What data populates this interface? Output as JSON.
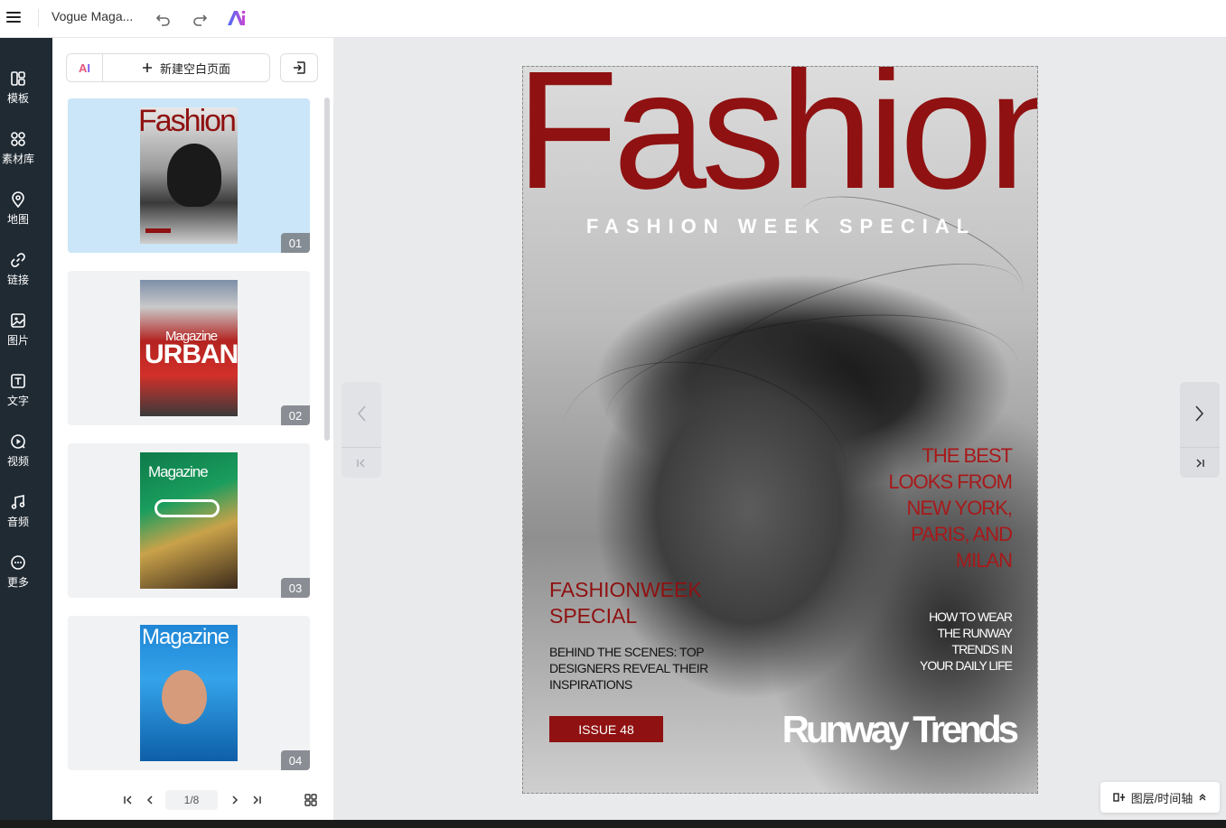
{
  "topbar": {
    "doc_title": "Vogue Maga...",
    "icons": [
      "menu-icon",
      "undo-icon",
      "redo-icon",
      "ai-logo-icon"
    ]
  },
  "rail": {
    "items": [
      {
        "label": "模板",
        "icon": "template-icon"
      },
      {
        "label": "素材库",
        "icon": "assets-icon"
      },
      {
        "label": "地图",
        "icon": "map-pin-icon"
      },
      {
        "label": "链接",
        "icon": "link-icon"
      },
      {
        "label": "图片",
        "icon": "image-icon"
      },
      {
        "label": "文字",
        "icon": "text-icon"
      },
      {
        "label": "视频",
        "icon": "video-icon"
      },
      {
        "label": "音频",
        "icon": "audio-icon"
      },
      {
        "label": "更多",
        "icon": "more-icon"
      }
    ]
  },
  "pages_panel": {
    "ai_label_a": "A",
    "ai_label_i": "I",
    "new_page_label": "新建空白页面",
    "thumbnails": [
      {
        "num": "01",
        "title": "Fashion",
        "active": true
      },
      {
        "num": "02",
        "title": "URBAN",
        "kicker": "Magazine",
        "active": false
      },
      {
        "num": "03",
        "title": "Magazine",
        "active": false
      },
      {
        "num": "04",
        "title": "Magazine",
        "active": false
      }
    ],
    "pager": {
      "current": "1/8"
    }
  },
  "cover": {
    "title": "Fashion",
    "subtitle": "FASHION WEEK SPECIAL",
    "headline_lines": [
      "THE BEST",
      "LOOKS FROM",
      "NEW YORK,",
      "PARIS, AND",
      "MILAN"
    ],
    "feature_title_lines": [
      "FASHIONWEEK",
      "SPECIAL"
    ],
    "feature_body": "BEHIND THE SCENES: TOP DESIGNERS REVEAL THEIR INSPIRATIONS",
    "issue": "ISSUE 48",
    "howto_lines": [
      "HOW TO WEAR",
      "THE RUNWAY",
      "TRENDS IN",
      "YOUR DAILY LIFE"
    ],
    "brand": "Runway Trends"
  },
  "layers_button": {
    "label": "图层/时间轴"
  },
  "colors": {
    "brand_red": "#8f1111",
    "rail_bg": "#1f2a33",
    "active_thumb": "#cbe6f8"
  }
}
